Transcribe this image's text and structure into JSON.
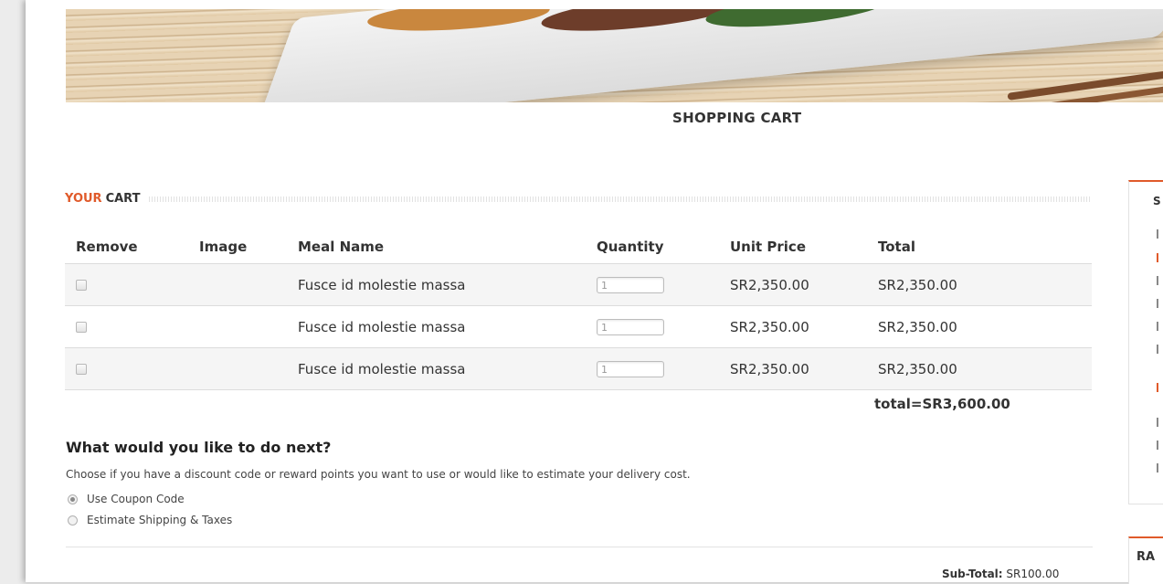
{
  "page_title": "SHOPPING CART",
  "cart_heading": {
    "accent": "YOUR",
    "rest": "CART"
  },
  "table": {
    "headers": [
      "Remove",
      "Image",
      "Meal Name",
      "Quantity",
      "Unit Price",
      "Total"
    ],
    "rows": [
      {
        "name": "Fusce id molestie massa",
        "qty": "1",
        "unit_price": "SR2,350.00",
        "total": "SR2,350.00"
      },
      {
        "name": "Fusce id molestie massa",
        "qty": "1",
        "unit_price": "SR2,350.00",
        "total": "SR2,350.00"
      },
      {
        "name": "Fusce id molestie massa",
        "qty": "1",
        "unit_price": "SR2,350.00",
        "total": "SR2,350.00"
      }
    ]
  },
  "grand_total": "total=SR3,600.00",
  "next": {
    "title": "What would you like to do next?",
    "description": "Choose if you have a discount code or reward points you want to use or would like to estimate your delivery cost.",
    "options": [
      {
        "label": "Use Coupon Code",
        "selected": true
      },
      {
        "label": "Estimate Shipping & Taxes",
        "selected": false
      }
    ]
  },
  "subtotal": {
    "label": "Sub-Total:",
    "value": "SR100.00"
  },
  "sidebar": {
    "box1_letter": "S",
    "box2_letters": "RA"
  },
  "colors": {
    "accent": "#e05a2a"
  }
}
